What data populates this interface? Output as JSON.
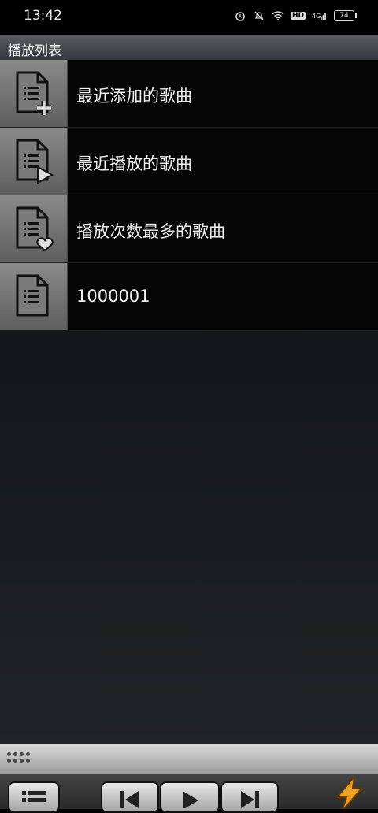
{
  "status_bar": {
    "time": "13:42",
    "battery": "74",
    "hd": "HD",
    "network": "4G"
  },
  "header": {
    "title": "播放列表"
  },
  "playlists": [
    {
      "label": "最近添加的歌曲",
      "icon": "playlist-add-icon"
    },
    {
      "label": "最近播放的歌曲",
      "icon": "playlist-play-icon"
    },
    {
      "label": "播放次数最多的歌曲",
      "icon": "playlist-heart-icon"
    },
    {
      "label": "1000001",
      "icon": "playlist-icon"
    }
  ],
  "controls": {
    "buttons": [
      "list-button",
      "previous-button",
      "play-button",
      "next-button",
      "shuffle-button"
    ]
  }
}
